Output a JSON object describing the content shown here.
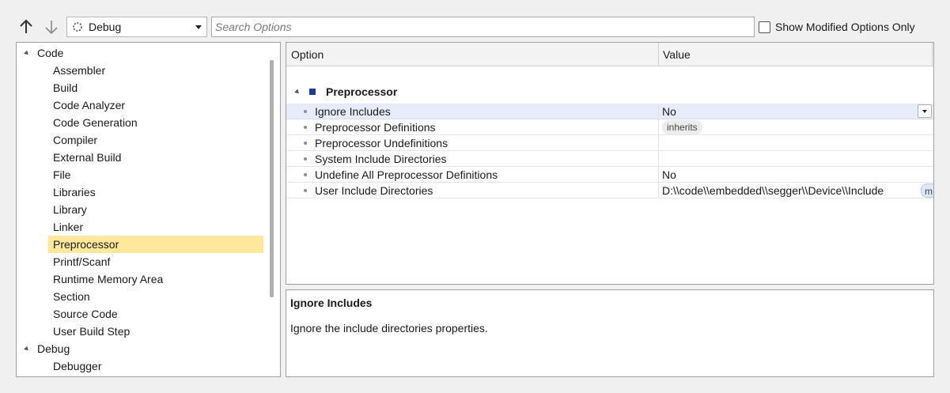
{
  "toolbar": {
    "up_icon": "arrow-up-icon",
    "down_icon": "arrow-down-icon",
    "configuration": "Debug",
    "search_placeholder": "Search Options",
    "show_modified_label": "Show Modified Options Only",
    "show_modified_checked": false
  },
  "tree": {
    "groups": [
      {
        "label": "Code",
        "expanded": true,
        "items": [
          "Assembler",
          "Build",
          "Code Analyzer",
          "Code Generation",
          "Compiler",
          "External Build",
          "File",
          "Libraries",
          "Library",
          "Linker",
          "Preprocessor",
          "Printf/Scanf",
          "Runtime Memory Area",
          "Section",
          "Source Code",
          "User Build Step"
        ]
      },
      {
        "label": "Debug",
        "expanded": true,
        "items": [
          "Debugger"
        ]
      }
    ],
    "selected": "Preprocessor"
  },
  "grid": {
    "columns": {
      "option": "Option",
      "value": "Value"
    },
    "category": "Preprocessor",
    "rows": [
      {
        "name": "Ignore Includes",
        "value": "No",
        "selected": true
      },
      {
        "name": "Preprocessor Definitions",
        "value": "inherits"
      },
      {
        "name": "Preprocessor Undefinitions",
        "value": ""
      },
      {
        "name": "System Include Directories",
        "value": ""
      },
      {
        "name": "Undefine All Preprocessor Definitions",
        "value": "No"
      },
      {
        "name": "User Include Directories",
        "value": "D:\\\\code\\\\embedded\\\\segger\\\\Device\\\\Include",
        "macro_badge": "m"
      }
    ]
  },
  "description": {
    "title": "Ignore Includes",
    "text": "Ignore the include directories properties."
  },
  "colors": {
    "selected_tree_item": "#fde89c",
    "selected_grid_row": "#e6ecfa",
    "category_square": "#1f3a9a"
  }
}
